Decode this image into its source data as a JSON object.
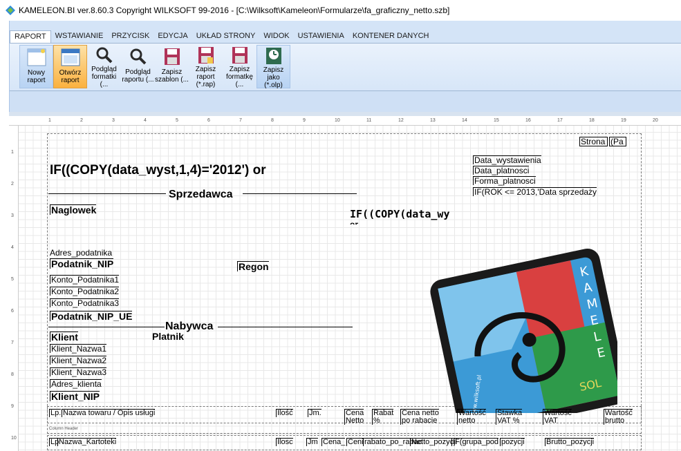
{
  "title": "KAMELEON.BI ver.8.60.3 Copyright WILKSOFT 99-2016 - [C:\\Wilksoft\\Kameleon\\Formularze\\fa_graficzny_netto.szb]",
  "tabs": [
    "RAPORT",
    "WSTAWIANIE",
    "PRZYCISK",
    "EDYCJA",
    "UKŁAD STRONY",
    "WIDOK",
    "USTAWIENIA",
    "KONTENER DANYCH"
  ],
  "buttons": [
    {
      "l1": "Nowy",
      "l2": "raport"
    },
    {
      "l1": "Otwórz",
      "l2": "raport"
    },
    {
      "l1": "Podgląd",
      "l2": "formatki (..."
    },
    {
      "l1": "Podgląd",
      "l2": "raportu (..."
    },
    {
      "l1": "Zapisz",
      "l2": "szablon (..."
    },
    {
      "l1": "Zapisz",
      "l2": "raport (*.rap)"
    },
    {
      "l1": "Zapisz",
      "l2": "formatkę (..."
    },
    {
      "l1": "Zapisz",
      "l2": "jako (*.olp)"
    }
  ],
  "ruler_top": [
    "1",
    "2",
    "3",
    "4",
    "5",
    "6",
    "7",
    "8",
    "9",
    "10",
    "11",
    "12",
    "13",
    "14",
    "15",
    "16",
    "17",
    "18",
    "19",
    "20"
  ],
  "ruler_left": [
    "1",
    "2",
    "3",
    "4",
    "5",
    "6",
    "7",
    "8",
    "9",
    "10"
  ],
  "report": {
    "strona": "Strona",
    "pa": "(Pa",
    "if_year": "IF((COPY(data_wyst,1,4)='2012') or",
    "data_wystawienia": "Data_wystawienia",
    "data_platnosci": "Data_platnosci",
    "forma_platnosci": "Forma_platnosci",
    "if_rok": "IF(ROK <= 2013,'Data sprzedaży",
    "sprzedawca": "Sprzedawca",
    "naglowek": "Naglowek",
    "if_copy2": "IF((COPY(data_wy",
    "or2": "or",
    "adres_podatnika": "Adres_podatnika",
    "podatnik_nip": "Podatnik_NIP",
    "regon": "Regon",
    "konto1": "Konto_Podatnika1",
    "konto2": "Konto_Podatnika2",
    "konto3": "Konto_Podatnika3",
    "podatnik_nip_ue": "Podatnik_NIP_UE",
    "nabywca": "Nabywca",
    "klient": "Klient",
    "platnik": "Platnik",
    "klient_nazwa1": "Klient_Nazwa1",
    "klient_nazwa2": "Klient_Nazwa2",
    "klient_nazwa3": "Klient_Nazwa3",
    "adres_klienta": "Adres_klienta",
    "klient_nip": "Klient_NIP",
    "logo_letters": [
      "K",
      "A",
      "M",
      "E",
      "L",
      "E"
    ],
    "logo_url": "www.wilksoft.pl",
    "logo_sol": "SOL"
  },
  "headers": [
    {
      "a": "Lp.",
      "b": ""
    },
    {
      "a": "Nazwa towaru / Opis usługi",
      "b": ""
    },
    {
      "a": "Ilość",
      "b": ""
    },
    {
      "a": "Jm.",
      "b": ""
    },
    {
      "a": "Cena",
      "b": "Netto"
    },
    {
      "a": "Rabat",
      "b": "%"
    },
    {
      "a": "Cena netto",
      "b": "po rabacie"
    },
    {
      "a": "Wartość",
      "b": "netto"
    },
    {
      "a": "Stawka",
      "b": "VAT %"
    },
    {
      "a": "Wartość",
      "b": "VAT"
    },
    {
      "a": "Wartość",
      "b": "brutto"
    }
  ],
  "column_header_caption": "Column Header",
  "detail": [
    "Lp",
    "Nazwa_Kartoteki",
    "Ilosc",
    "Jm",
    "Cena_",
    "Ceni",
    "rabato_po_rabac",
    "Netto_pozycji",
    "IF(grupa_pod",
    "pozycji",
    "Brutto_pozycji"
  ],
  "colors": {
    "ribbon": "#d4e4f7",
    "accent": "#fbb13f"
  }
}
